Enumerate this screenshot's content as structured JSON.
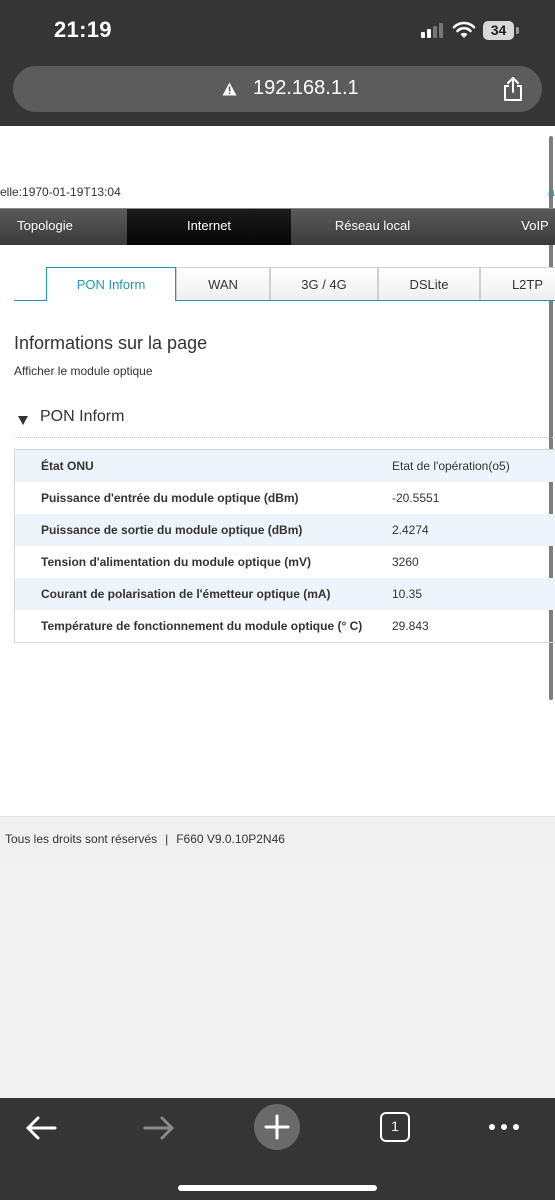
{
  "status_bar": {
    "time": "21:19",
    "battery": "34"
  },
  "browser": {
    "url": "192.168.1.1",
    "tab_count": "1"
  },
  "page": {
    "datetime_line": "elle:1970-01-19T13:04",
    "right_edge_char": "a",
    "nav": [
      "Topologie",
      "Internet",
      "Réseau local",
      "VoIP"
    ],
    "active_nav": "Internet",
    "subtabs": [
      "PON Inform",
      "WAN",
      "3G / 4G",
      "DSLite",
      "L2TP"
    ],
    "active_subtab": "PON Inform",
    "title": "Informations sur la page",
    "description": "Afficher le module optique",
    "section_title": "PON Inform",
    "rows": [
      {
        "label": "État ONU",
        "value": "Etat de l'opération(o5)"
      },
      {
        "label": "Puissance d'entrée du module optique (dBm)",
        "value": "-20.5551"
      },
      {
        "label": "Puissance de sortie du module optique (dBm)",
        "value": "2.4274"
      },
      {
        "label": "Tension d'alimentation du module optique (mV)",
        "value": "3260"
      },
      {
        "label": "Courant de polarisation de l'émetteur optique (mA)",
        "value": "10.35"
      },
      {
        "label": "Température de fonctionnement du module optique (° C)",
        "value": "29.843"
      }
    ],
    "footer": {
      "rights": "Tous les droits sont réservés",
      "separator": "|",
      "version": "F660 V9.0.10P2N46"
    }
  },
  "toolbar": {
    "icons": [
      "back-arrow-icon",
      "forward-arrow-icon",
      "new-tab-plus-icon",
      "tabs-count-icon",
      "more-icon"
    ]
  },
  "colors": {
    "accent": "#1e9ab0",
    "chrome": "#353535",
    "shaded_row": "#eef4fb"
  }
}
